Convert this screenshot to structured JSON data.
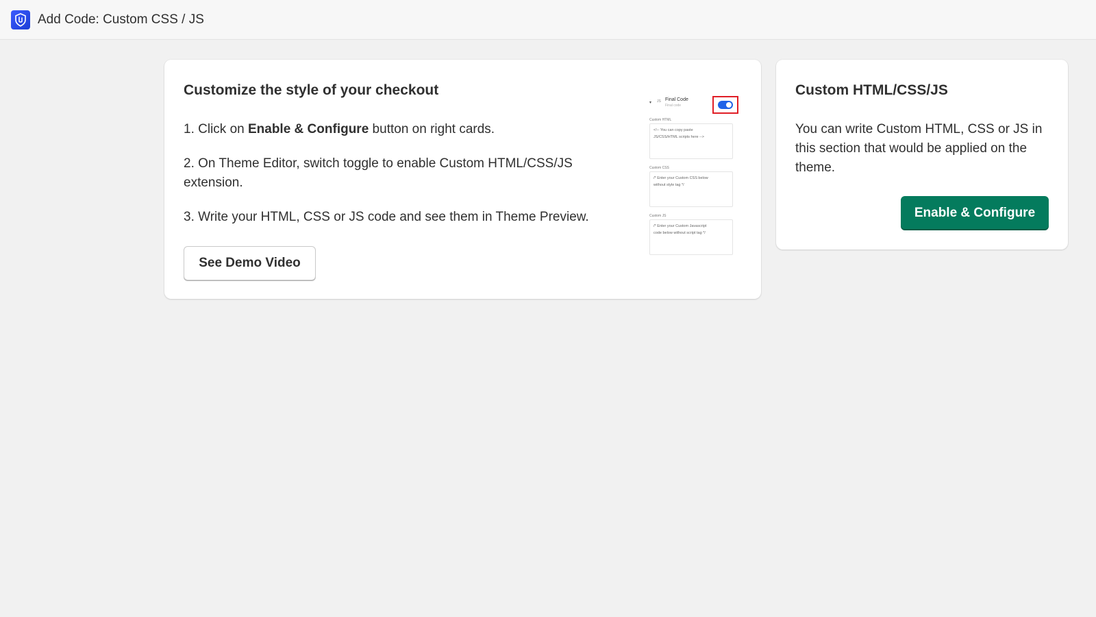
{
  "app": {
    "title": "Add Code: Custom CSS / JS",
    "icon": "clip-shield-icon",
    "accent": "#2f51f5"
  },
  "left_card": {
    "title": "Customize the style of your checkout",
    "steps": [
      {
        "prefix": "1. Click on ",
        "bold": "Enable & Configure",
        "suffix": " button on right cards."
      },
      {
        "prefix": "2. On Theme Editor, switch toggle to enable Custom HTML/CSS/JS extension.",
        "bold": "",
        "suffix": ""
      },
      {
        "prefix": "3. Write your HTML, CSS or JS code and see them in Theme Preview.",
        "bold": "",
        "suffix": ""
      }
    ],
    "demo_button": "See Demo Video",
    "preview": {
      "js_tag": "JS",
      "block_name": "Final Code",
      "block_sub": "Final code",
      "toggle_on": true,
      "toggle_color": "#1f62e8",
      "highlight_color": "#e01e26",
      "sections": [
        {
          "label": "Custom HTML",
          "lines": [
            "<!-- You can copy paste",
            "JS/CSS/HTML scripts here -->"
          ]
        },
        {
          "label": "Custom CSS",
          "lines": [
            "/* Enter your Custom CSS below",
            "without style tag */"
          ]
        },
        {
          "label": "Custom JS",
          "lines": [
            "/* Enter your Custom Javascript",
            "code below without script tag */"
          ]
        }
      ]
    }
  },
  "right_card": {
    "title": "Custom HTML/CSS/JS",
    "description": "You can write Custom HTML, CSS or JS in this section that would be applied on the theme.",
    "enable_button": "Enable & Configure",
    "button_color": "#047b5d"
  }
}
